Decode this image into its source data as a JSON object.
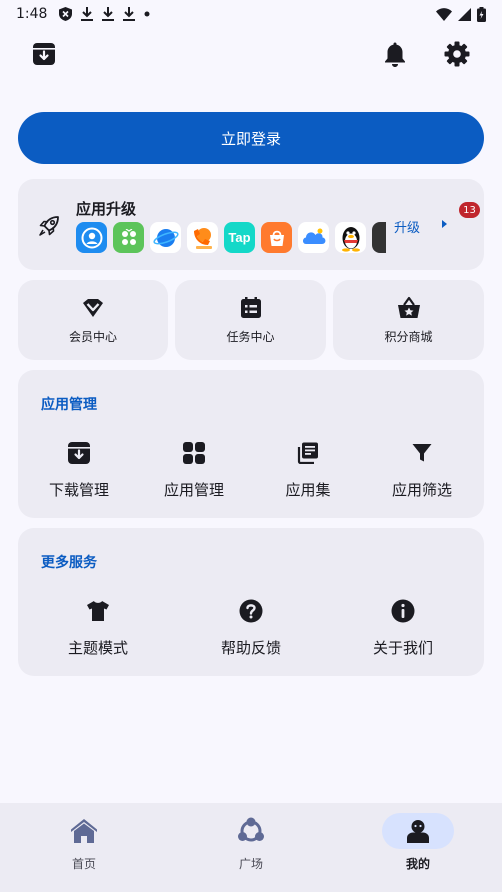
{
  "status_bar": {
    "time": "1:48",
    "icons": [
      "shield-x-icon",
      "download-icon",
      "download-icon",
      "download-icon",
      "dot-icon"
    ],
    "right_icons": [
      "wifi-icon",
      "signal-icon",
      "battery-icon"
    ]
  },
  "top_bar": {
    "left_icon": "archive-download-icon",
    "right_icons": [
      "bell-icon",
      "gear-icon"
    ]
  },
  "login_button": "立即登录",
  "upgrade": {
    "title": "应用升级",
    "action_label": "升级",
    "badge_count": "13",
    "apps": [
      {
        "name": "app-blue-person",
        "color": "#1e8cf0"
      },
      {
        "name": "app-green-grid",
        "color": "#5cc45a"
      },
      {
        "name": "app-planet",
        "color": "#ffffff"
      },
      {
        "name": "app-orange-phone",
        "color": "#ffffff"
      },
      {
        "name": "app-tap",
        "color": "#14d8c8",
        "label": "Tap"
      },
      {
        "name": "app-orange-bag",
        "color": "#ff7a2e"
      },
      {
        "name": "app-blue-cloud",
        "color": "#ffffff"
      },
      {
        "name": "app-penguin",
        "color": "#ffffff"
      },
      {
        "name": "app-dark",
        "color": "#333333"
      }
    ]
  },
  "quick_actions": [
    {
      "label": "会员中心",
      "icon": "vip-chevron-icon"
    },
    {
      "label": "任务中心",
      "icon": "task-calendar-icon"
    },
    {
      "label": "积分商城",
      "icon": "star-basket-icon"
    }
  ],
  "app_management": {
    "title": "应用管理",
    "items": [
      {
        "label": "下载管理",
        "icon": "download-box-icon"
      },
      {
        "label": "应用管理",
        "icon": "apps-grid-icon"
      },
      {
        "label": "应用集",
        "icon": "collection-icon"
      },
      {
        "label": "应用筛选",
        "icon": "filter-icon"
      }
    ]
  },
  "more_services": {
    "title": "更多服务",
    "items": [
      {
        "label": "主题模式",
        "icon": "tshirt-icon"
      },
      {
        "label": "帮助反馈",
        "icon": "help-circle-icon"
      },
      {
        "label": "关于我们",
        "icon": "info-circle-icon"
      }
    ]
  },
  "bottom_nav": [
    {
      "label": "首页",
      "icon": "home-icon",
      "active": false
    },
    {
      "label": "广场",
      "icon": "community-icon",
      "active": false
    },
    {
      "label": "我的",
      "icon": "profile-icon",
      "active": true
    }
  ],
  "colors": {
    "accent": "#0b5cc2",
    "background": "#f8f7fe",
    "card": "#ecebf3",
    "badge": "#c0262d",
    "active_pill": "#d7e2fe"
  }
}
